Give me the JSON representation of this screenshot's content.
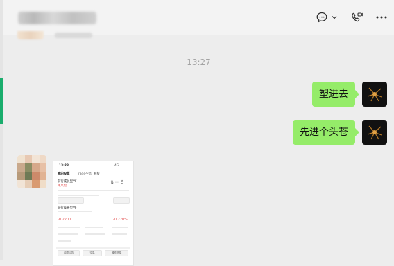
{
  "header": {
    "chat_icon": "chat-bubble-icon",
    "chevron_icon": "chevron-down-icon",
    "call_icon": "video-call-icon",
    "more_icon": "more-horizontal-icon"
  },
  "chat": {
    "timestamp": "13:27",
    "messages": [
      {
        "side": "right",
        "text": "塑进去"
      },
      {
        "side": "right",
        "text": "先进个头苍"
      }
    ],
    "screenshot": {
      "time": "13:28",
      "signal": "4G",
      "tab_main": "我的股票",
      "tab_2": "Trade不错",
      "tab_3": "看板",
      "fund_1": "前行成长型VF",
      "tag_1": "中风险",
      "fund_2": "前行成长型VF",
      "value_red": "-0.2200",
      "value_red_2": "-0.220%",
      "footer_1": "金额公告",
      "footer_2": "交易",
      "footer_3": "操作选择"
    }
  },
  "colors": {
    "bubble": "#95ec69",
    "accent": "#1aad6d",
    "background": "#ededed"
  }
}
